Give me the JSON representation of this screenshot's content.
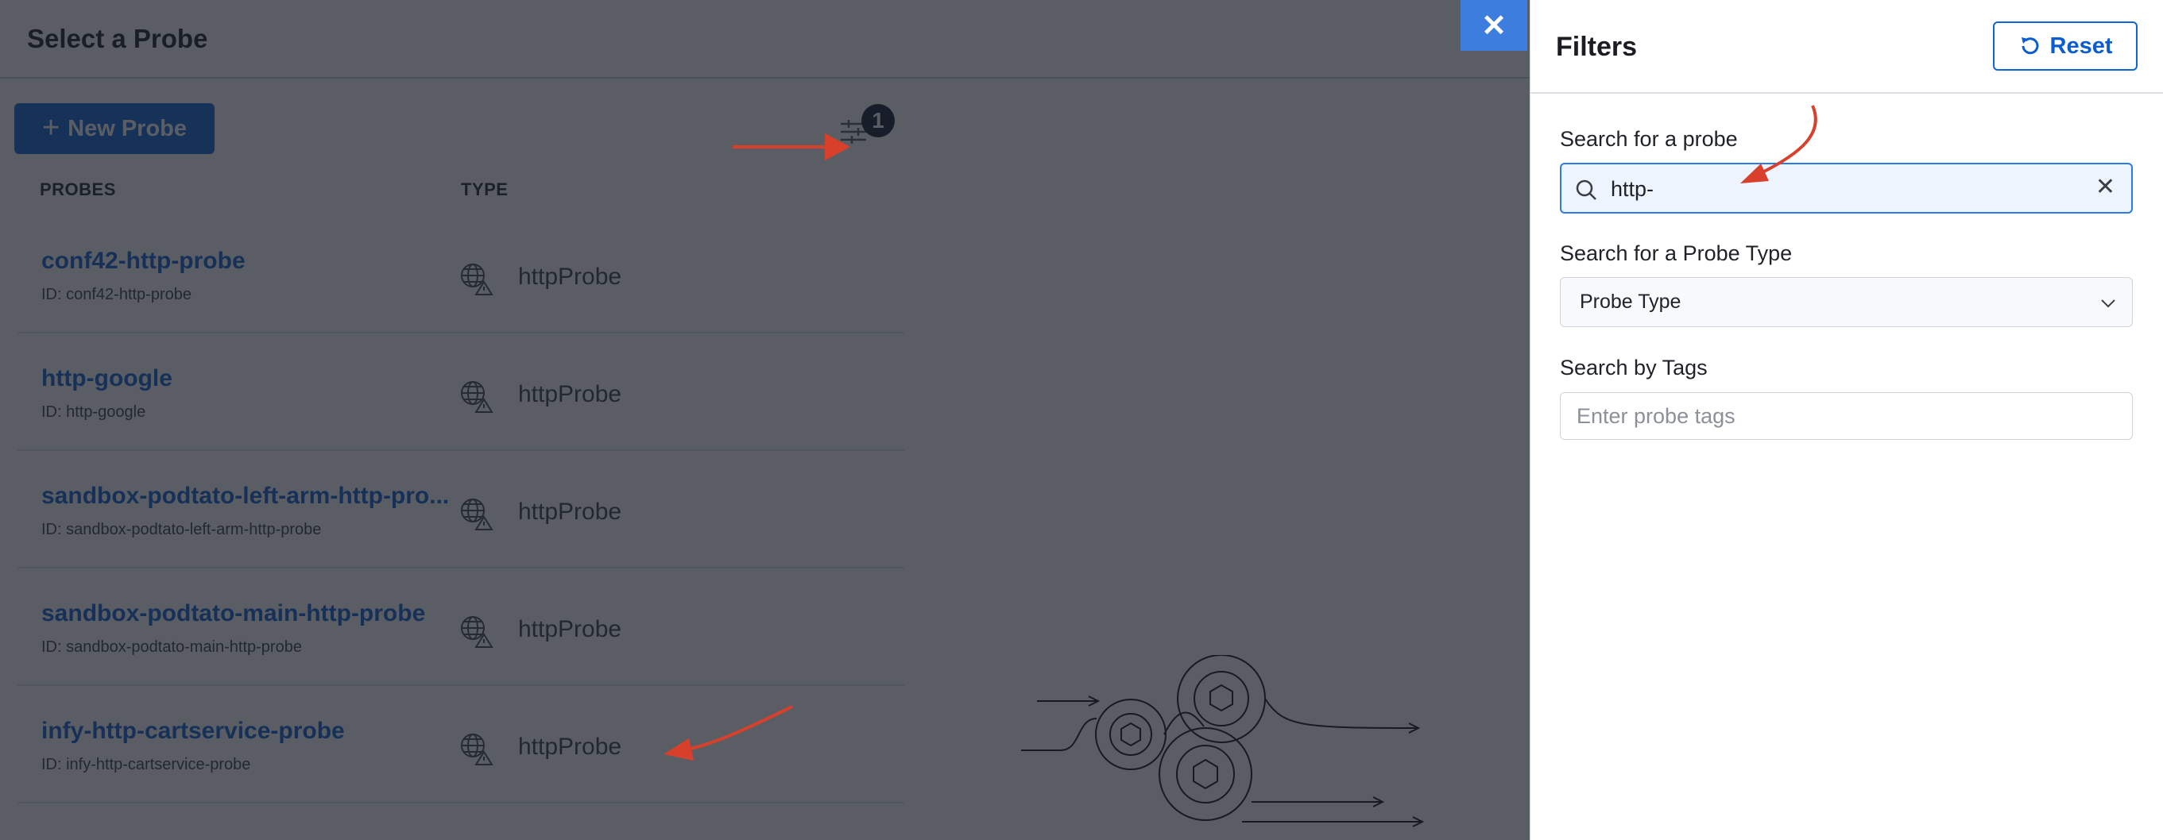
{
  "modal": {
    "title": "Select a Probe",
    "new_probe_label": "New Probe",
    "filter_count": "1",
    "columns": [
      "PROBES",
      "TYPE"
    ],
    "probes": [
      {
        "name": "conf42-http-probe",
        "id": "ID: conf42-http-probe",
        "type": "httpProbe"
      },
      {
        "name": "http-google",
        "id": "ID: http-google",
        "type": "httpProbe"
      },
      {
        "name": "sandbox-podtato-left-arm-http-pro...",
        "id": "ID: sandbox-podtato-left-arm-http-probe",
        "type": "httpProbe"
      },
      {
        "name": "sandbox-podtato-main-http-probe",
        "id": "ID: sandbox-podtato-main-http-probe",
        "type": "httpProbe"
      },
      {
        "name": "infy-http-cartservice-probe",
        "id": "ID: infy-http-cartservice-probe",
        "type": "httpProbe"
      }
    ],
    "close_glyph": "✕"
  },
  "filters": {
    "title": "Filters",
    "reset_label": "Reset",
    "search_label": "Search for a probe",
    "search_value": "http-",
    "type_label": "Search for a Probe Type",
    "type_value": "Probe Type",
    "tags_label": "Search by Tags",
    "tags_placeholder": "Enter probe tags"
  },
  "icons": {
    "plus": "plus-icon",
    "filter": "filter-sliders-icon",
    "type": "globe-warning-icon",
    "close": "close-icon",
    "reset": "refresh-icon",
    "search": "search-icon",
    "clear": "clear-icon",
    "chevron": "chevron-down-icon"
  },
  "colors": {
    "accent": "#0b63d4",
    "link": "#0b5ccf",
    "annotation_arrow": "#d9402b"
  }
}
